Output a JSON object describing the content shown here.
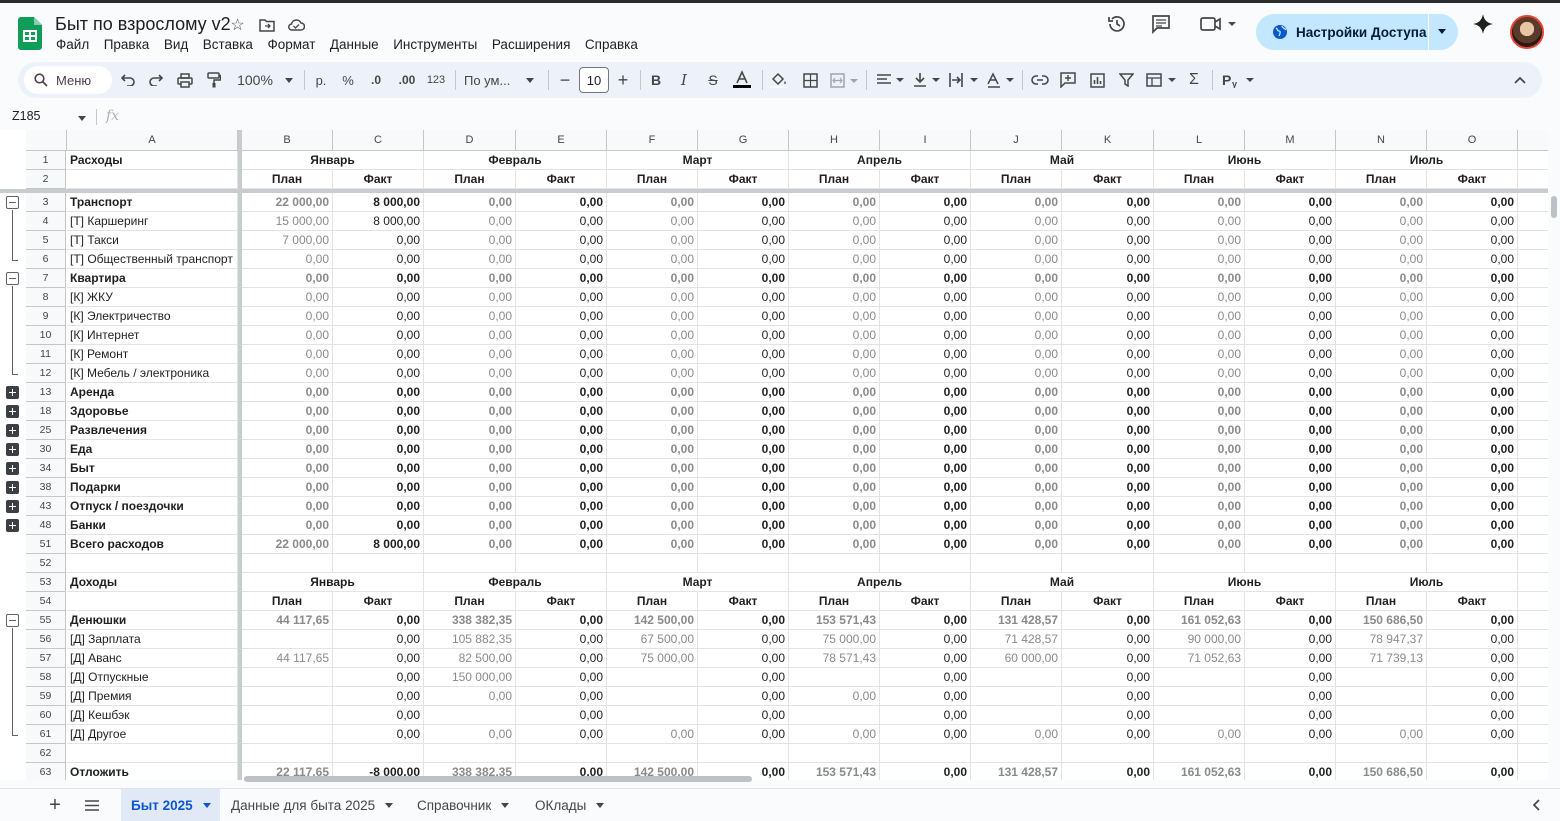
{
  "app": {
    "doc_title": "Быт по взрослому v2"
  },
  "menu": [
    "Файл",
    "Правка",
    "Вид",
    "Вставка",
    "Формат",
    "Данные",
    "Инструменты",
    "Расширения",
    "Справка"
  ],
  "share": {
    "label": "Настройки Доступа"
  },
  "toolbar": {
    "search_label": "Меню",
    "zoom": "100%",
    "currency": "р.",
    "percent": "%",
    "dec_dec": ".0",
    "dec_inc": ".00",
    "number_format": "123",
    "font": "По ум...",
    "font_size": "10"
  },
  "formula_bar": {
    "cell_ref": "Z185",
    "fx": "fx"
  },
  "columns": [
    "A",
    "B",
    "C",
    "D",
    "E",
    "F",
    "G",
    "H",
    "I",
    "J",
    "K",
    "L",
    "M",
    "N",
    "O"
  ],
  "rows": [
    {
      "n": "1",
      "a": "Расходы",
      "bold": true,
      "kind": "month"
    },
    {
      "n": "2",
      "a": "",
      "kind": "planfact"
    },
    {
      "n": "3",
      "a": "Транспорт",
      "bold": true,
      "v": [
        "22 000,00",
        "8 000,00",
        "0,00",
        "0,00",
        "0,00",
        "0,00",
        "0,00",
        "0,00",
        "0,00",
        "0,00",
        "0,00",
        "0,00",
        "0,00",
        "0,00"
      ]
    },
    {
      "n": "4",
      "a": "[Т] Каршеринг",
      "v": [
        "15 000,00",
        "8 000,00",
        "0,00",
        "0,00",
        "0,00",
        "0,00",
        "0,00",
        "0,00",
        "0,00",
        "0,00",
        "0,00",
        "0,00",
        "0,00",
        "0,00"
      ]
    },
    {
      "n": "5",
      "a": "[Т] Такси",
      "v": [
        "7 000,00",
        "0,00",
        "0,00",
        "0,00",
        "0,00",
        "0,00",
        "0,00",
        "0,00",
        "0,00",
        "0,00",
        "0,00",
        "0,00",
        "0,00",
        "0,00"
      ]
    },
    {
      "n": "6",
      "a": "[Т] Общественный транспорт",
      "v": [
        "0,00",
        "0,00",
        "0,00",
        "0,00",
        "0,00",
        "0,00",
        "0,00",
        "0,00",
        "0,00",
        "0,00",
        "0,00",
        "0,00",
        "0,00",
        "0,00"
      ]
    },
    {
      "n": "7",
      "a": "Квартира",
      "bold": true,
      "v": [
        "0,00",
        "0,00",
        "0,00",
        "0,00",
        "0,00",
        "0,00",
        "0,00",
        "0,00",
        "0,00",
        "0,00",
        "0,00",
        "0,00",
        "0,00",
        "0,00"
      ]
    },
    {
      "n": "8",
      "a": "[К] ЖКУ",
      "v": [
        "0,00",
        "0,00",
        "0,00",
        "0,00",
        "0,00",
        "0,00",
        "0,00",
        "0,00",
        "0,00",
        "0,00",
        "0,00",
        "0,00",
        "0,00",
        "0,00"
      ]
    },
    {
      "n": "9",
      "a": "[К] Электричество",
      "v": [
        "0,00",
        "0,00",
        "0,00",
        "0,00",
        "0,00",
        "0,00",
        "0,00",
        "0,00",
        "0,00",
        "0,00",
        "0,00",
        "0,00",
        "0,00",
        "0,00"
      ]
    },
    {
      "n": "10",
      "a": "[К] Интернет",
      "v": [
        "0,00",
        "0,00",
        "0,00",
        "0,00",
        "0,00",
        "0,00",
        "0,00",
        "0,00",
        "0,00",
        "0,00",
        "0,00",
        "0,00",
        "0,00",
        "0,00"
      ]
    },
    {
      "n": "11",
      "a": "[К] Ремонт",
      "v": [
        "0,00",
        "0,00",
        "0,00",
        "0,00",
        "0,00",
        "0,00",
        "0,00",
        "0,00",
        "0,00",
        "0,00",
        "0,00",
        "0,00",
        "0,00",
        "0,00"
      ]
    },
    {
      "n": "12",
      "a": "[К] Мебель / электроника",
      "v": [
        "0,00",
        "0,00",
        "0,00",
        "0,00",
        "0,00",
        "0,00",
        "0,00",
        "0,00",
        "0,00",
        "0,00",
        "0,00",
        "0,00",
        "0,00",
        "0,00"
      ]
    },
    {
      "n": "13",
      "a": "Аренда",
      "bold": true,
      "v": [
        "0,00",
        "0,00",
        "0,00",
        "0,00",
        "0,00",
        "0,00",
        "0,00",
        "0,00",
        "0,00",
        "0,00",
        "0,00",
        "0,00",
        "0,00",
        "0,00"
      ]
    },
    {
      "n": "18",
      "a": "Здоровье",
      "bold": true,
      "v": [
        "0,00",
        "0,00",
        "0,00",
        "0,00",
        "0,00",
        "0,00",
        "0,00",
        "0,00",
        "0,00",
        "0,00",
        "0,00",
        "0,00",
        "0,00",
        "0,00"
      ]
    },
    {
      "n": "25",
      "a": "Развлечения",
      "bold": true,
      "v": [
        "0,00",
        "0,00",
        "0,00",
        "0,00",
        "0,00",
        "0,00",
        "0,00",
        "0,00",
        "0,00",
        "0,00",
        "0,00",
        "0,00",
        "0,00",
        "0,00"
      ]
    },
    {
      "n": "30",
      "a": "Еда",
      "bold": true,
      "v": [
        "0,00",
        "0,00",
        "0,00",
        "0,00",
        "0,00",
        "0,00",
        "0,00",
        "0,00",
        "0,00",
        "0,00",
        "0,00",
        "0,00",
        "0,00",
        "0,00"
      ]
    },
    {
      "n": "34",
      "a": "Быт",
      "bold": true,
      "v": [
        "0,00",
        "0,00",
        "0,00",
        "0,00",
        "0,00",
        "0,00",
        "0,00",
        "0,00",
        "0,00",
        "0,00",
        "0,00",
        "0,00",
        "0,00",
        "0,00"
      ]
    },
    {
      "n": "38",
      "a": "Подарки",
      "bold": true,
      "v": [
        "0,00",
        "0,00",
        "0,00",
        "0,00",
        "0,00",
        "0,00",
        "0,00",
        "0,00",
        "0,00",
        "0,00",
        "0,00",
        "0,00",
        "0,00",
        "0,00"
      ]
    },
    {
      "n": "43",
      "a": "Отпуск / поездочки",
      "bold": true,
      "v": [
        "0,00",
        "0,00",
        "0,00",
        "0,00",
        "0,00",
        "0,00",
        "0,00",
        "0,00",
        "0,00",
        "0,00",
        "0,00",
        "0,00",
        "0,00",
        "0,00"
      ]
    },
    {
      "n": "48",
      "a": "Банки",
      "bold": true,
      "v": [
        "0,00",
        "0,00",
        "0,00",
        "0,00",
        "0,00",
        "0,00",
        "0,00",
        "0,00",
        "0,00",
        "0,00",
        "0,00",
        "0,00",
        "0,00",
        "0,00"
      ]
    },
    {
      "n": "51",
      "a": "Всего расходов",
      "bold": true,
      "v": [
        "22 000,00",
        "8 000,00",
        "0,00",
        "0,00",
        "0,00",
        "0,00",
        "0,00",
        "0,00",
        "0,00",
        "0,00",
        "0,00",
        "0,00",
        "0,00",
        "0,00"
      ]
    },
    {
      "n": "52",
      "a": "",
      "v": [
        "",
        "",
        "",
        "",
        "",
        "",
        "",
        "",
        "",
        "",
        "",
        "",
        "",
        ""
      ]
    },
    {
      "n": "53",
      "a": "Доходы",
      "bold": true,
      "kind": "month"
    },
    {
      "n": "54",
      "a": "",
      "kind": "planfact"
    },
    {
      "n": "55",
      "a": "Денюшки",
      "bold": true,
      "v": [
        "44 117,65",
        "0,00",
        "338 382,35",
        "0,00",
        "142 500,00",
        "0,00",
        "153 571,43",
        "0,00",
        "131 428,57",
        "0,00",
        "161 052,63",
        "0,00",
        "150 686,50",
        "0,00"
      ]
    },
    {
      "n": "56",
      "a": "[Д] Зарплата",
      "v": [
        "",
        "0,00",
        "105 882,35",
        "0,00",
        "67 500,00",
        "0,00",
        "75 000,00",
        "0,00",
        "71 428,57",
        "0,00",
        "90 000,00",
        "0,00",
        "78 947,37",
        "0,00"
      ]
    },
    {
      "n": "57",
      "a": "[Д] Аванс",
      "v": [
        "44 117,65",
        "0,00",
        "82 500,00",
        "0,00",
        "75 000,00",
        "0,00",
        "78 571,43",
        "0,00",
        "60 000,00",
        "0,00",
        "71 052,63",
        "0,00",
        "71 739,13",
        "0,00"
      ]
    },
    {
      "n": "58",
      "a": "[Д] Отпускные",
      "v": [
        "",
        "0,00",
        "150 000,00",
        "0,00",
        "",
        "0,00",
        "",
        "0,00",
        "",
        "0,00",
        "",
        "0,00",
        "",
        "0,00"
      ]
    },
    {
      "n": "59",
      "a": "[Д] Премия",
      "v": [
        "",
        "0,00",
        "0,00",
        "0,00",
        "",
        "0,00",
        "0,00",
        "0,00",
        "",
        "0,00",
        "",
        "0,00",
        "",
        "0,00"
      ]
    },
    {
      "n": "60",
      "a": "[Д] Кешбэк",
      "v": [
        "",
        "0,00",
        "",
        "0,00",
        "",
        "0,00",
        "",
        "0,00",
        "",
        "0,00",
        "",
        "0,00",
        "",
        "0,00"
      ]
    },
    {
      "n": "61",
      "a": "[Д] Другое",
      "v": [
        "",
        "0,00",
        "0,00",
        "0,00",
        "0,00",
        "0,00",
        "0,00",
        "0,00",
        "0,00",
        "0,00",
        "0,00",
        "0,00",
        "0,00",
        "0,00"
      ]
    },
    {
      "n": "62",
      "a": "",
      "v": [
        "",
        "",
        "",
        "",
        "",
        "",
        "",
        "",
        "",
        "",
        "",
        "",
        "",
        ""
      ]
    },
    {
      "n": "63",
      "a": "Отложить",
      "bold": true,
      "v": [
        "22 117,65",
        "-8 000,00",
        "338 382,35",
        "0,00",
        "142 500,00",
        "0,00",
        "153 571,43",
        "0,00",
        "131 428,57",
        "0,00",
        "161 052,63",
        "0,00",
        "150 686,50",
        "0,00"
      ]
    }
  ],
  "months": [
    "Январь",
    "Февраль",
    "Март",
    "Апрель",
    "Май",
    "Июнь",
    "Июль"
  ],
  "plan_label": "План",
  "fact_label": "Факт",
  "sheet_tabs": [
    "Быт 2025",
    "Данные для быта 2025",
    "Справочник",
    "ОКлады"
  ],
  "colors": {
    "accent": "#0b57d0",
    "share_bg": "#c2e7ff",
    "sheets_green": "#0f9d58"
  }
}
